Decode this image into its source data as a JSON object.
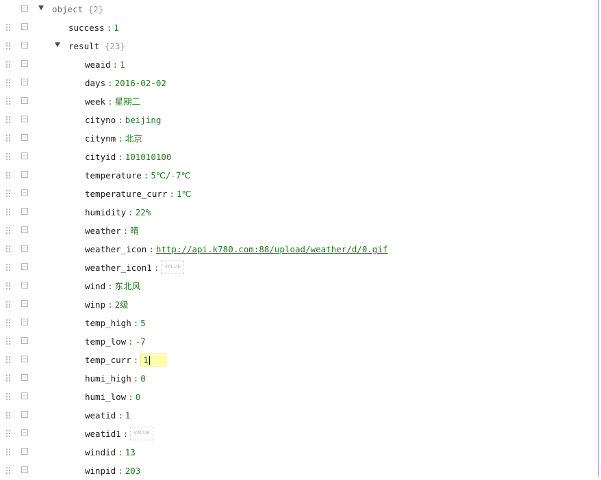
{
  "root": {
    "name": "object",
    "count": "{2}"
  },
  "success": {
    "key": "success",
    "value": "1"
  },
  "result": {
    "key": "result",
    "count": "{23}"
  },
  "fields": [
    {
      "key": "weaid",
      "value": "1",
      "type": "num"
    },
    {
      "key": "days",
      "value": "2016-02-02",
      "type": "str"
    },
    {
      "key": "week",
      "value": "星期二",
      "type": "str"
    },
    {
      "key": "cityno",
      "value": "beijing",
      "type": "str"
    },
    {
      "key": "citynm",
      "value": "北京",
      "type": "str"
    },
    {
      "key": "cityid",
      "value": "101010100",
      "type": "str"
    },
    {
      "key": "temperature",
      "value": "5℃/-7℃",
      "type": "str"
    },
    {
      "key": "temperature_curr",
      "value": "1℃",
      "type": "str"
    },
    {
      "key": "humidity",
      "value": "22%",
      "type": "str"
    },
    {
      "key": "weather",
      "value": "晴",
      "type": "str"
    },
    {
      "key": "weather_icon",
      "value": "http://api.k780.com:88/upload/weather/d/0.gif",
      "type": "url"
    },
    {
      "key": "weather_icon1",
      "value": "",
      "type": "empty"
    },
    {
      "key": "wind",
      "value": "东北风",
      "type": "str"
    },
    {
      "key": "winp",
      "value": "2级",
      "type": "str"
    },
    {
      "key": "temp_high",
      "value": "5",
      "type": "num"
    },
    {
      "key": "temp_low",
      "value": "-7",
      "type": "num"
    },
    {
      "key": "temp_curr",
      "value": "1",
      "type": "editing"
    },
    {
      "key": "humi_high",
      "value": "0",
      "type": "num"
    },
    {
      "key": "humi_low",
      "value": "0",
      "type": "num"
    },
    {
      "key": "weatid",
      "value": "1",
      "type": "num"
    },
    {
      "key": "weatid1",
      "value": "",
      "type": "empty"
    },
    {
      "key": "windid",
      "value": "13",
      "type": "num"
    },
    {
      "key": "winpid",
      "value": "203",
      "type": "num"
    }
  ],
  "labels": {
    "separator": ":",
    "empty_placeholder": "VALUE"
  }
}
